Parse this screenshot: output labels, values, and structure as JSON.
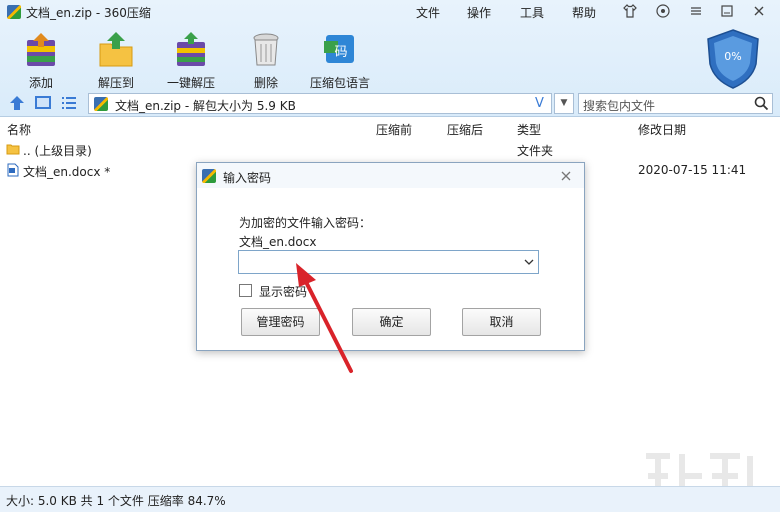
{
  "window": {
    "title": "文档_en.zip - 360压缩",
    "menu": [
      "文件",
      "操作",
      "工具",
      "帮助"
    ]
  },
  "toolbar": {
    "add": "添加",
    "extract_to": "解压到",
    "one_click": "一键解压",
    "delete": "删除",
    "language": "压缩包语言"
  },
  "shield": {
    "percent": "0%"
  },
  "address": {
    "path": "文档_en.zip - 解包大小为 5.9 KB",
    "search_placeholder": "搜索包内文件"
  },
  "columns": {
    "name": "名称",
    "before": "压缩前",
    "after": "压缩后",
    "type": "类型",
    "modified": "修改日期"
  },
  "rows": [
    {
      "name": ".. (上级目录)",
      "type": "文件夹",
      "date": ""
    },
    {
      "name": "文档_en.docx *",
      "type": "",
      "date": "2020-07-15 11:41"
    }
  ],
  "status": {
    "text": "大小: 5.0 KB 共 1 个文件 压缩率 84.7%"
  },
  "dialog": {
    "title": "输入密码",
    "label": "为加密的文件输入密码：",
    "file": "文档_en.docx",
    "password_value": "",
    "show_password": "显示密码",
    "manage": "管理密码",
    "ok": "确定",
    "cancel": "取消"
  },
  "colors": {
    "accent": "#3a7bd5",
    "arrow": "#d9232a",
    "shield": "#2f6fc0"
  }
}
